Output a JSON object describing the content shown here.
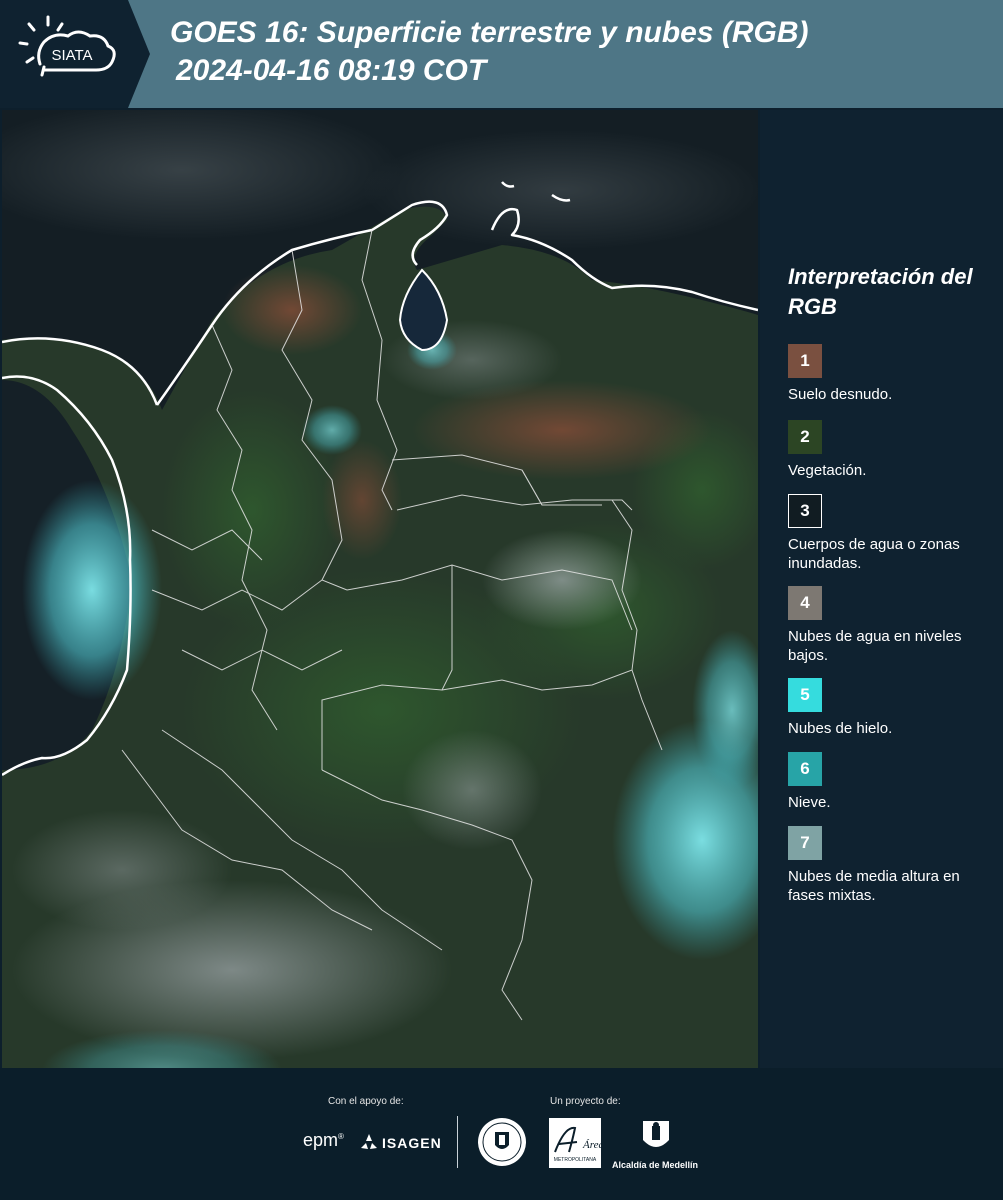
{
  "header": {
    "logo_text": "SIATA",
    "title_line1": "GOES 16: Superficie terrestre y nubes (RGB)",
    "title_line2": "2024-04-16 08:19 COT"
  },
  "legend": {
    "title": "Interpretación del RGB",
    "items": [
      {
        "num": "1",
        "label": "Suelo desnudo.",
        "color": "#7a5040"
      },
      {
        "num": "2",
        "label": "Vegetación.",
        "color": "#2c4524"
      },
      {
        "num": "3",
        "label": "Cuerpos de agua o zonas inundadas.",
        "color": "#111c22"
      },
      {
        "num": "4",
        "label": "Nubes de agua en niveles bajos.",
        "color": "#7d7872"
      },
      {
        "num": "5",
        "label": "Nubes de hielo.",
        "color": "#35dcde"
      },
      {
        "num": "6",
        "label": "Nieve.",
        "color": "#27a4a7"
      },
      {
        "num": "7",
        "label": "Nubes de media altura en fases mixtas.",
        "color": "#7fa3a4"
      }
    ]
  },
  "footer": {
    "support_label": "Con el apoyo de:",
    "project_label": "Un proyecto de:",
    "sponsor1": "epm",
    "sponsor2": "ISAGEN",
    "partner_area_text": "Área",
    "partner_area_sub": "METROPOLITANA",
    "partner_alcaldia": "Alcaldía de Medellín"
  }
}
